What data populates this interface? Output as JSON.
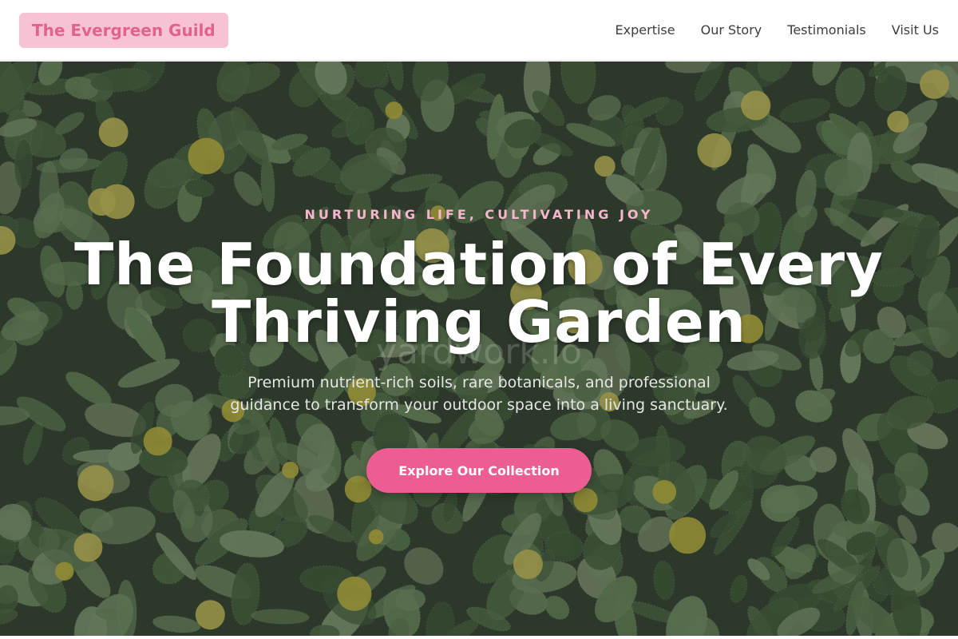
{
  "header": {
    "brand": "The Evergreen Guild",
    "nav": [
      "Expertise",
      "Our Story",
      "Testimonials",
      "Visit Us"
    ]
  },
  "hero": {
    "tagline": "NURTURING LIFE, CULTIVATING JOY",
    "headline": "The Foundation of Every Thriving Garden",
    "watermark": "yardwork.io",
    "subtitle": "Premium nutrient-rich soils, rare botanicals, and professional guidance to transform your outdoor space into a living sanctuary.",
    "cta_label": "Explore Our Collection",
    "background_image": "succulent-plants-photo"
  },
  "colors": {
    "brand_bg": "#f7c3d4",
    "brand_text": "#e2628f",
    "accent": "#ec5e93",
    "tagline": "#f8b6cc",
    "nav_text": "#3d3d3d"
  }
}
